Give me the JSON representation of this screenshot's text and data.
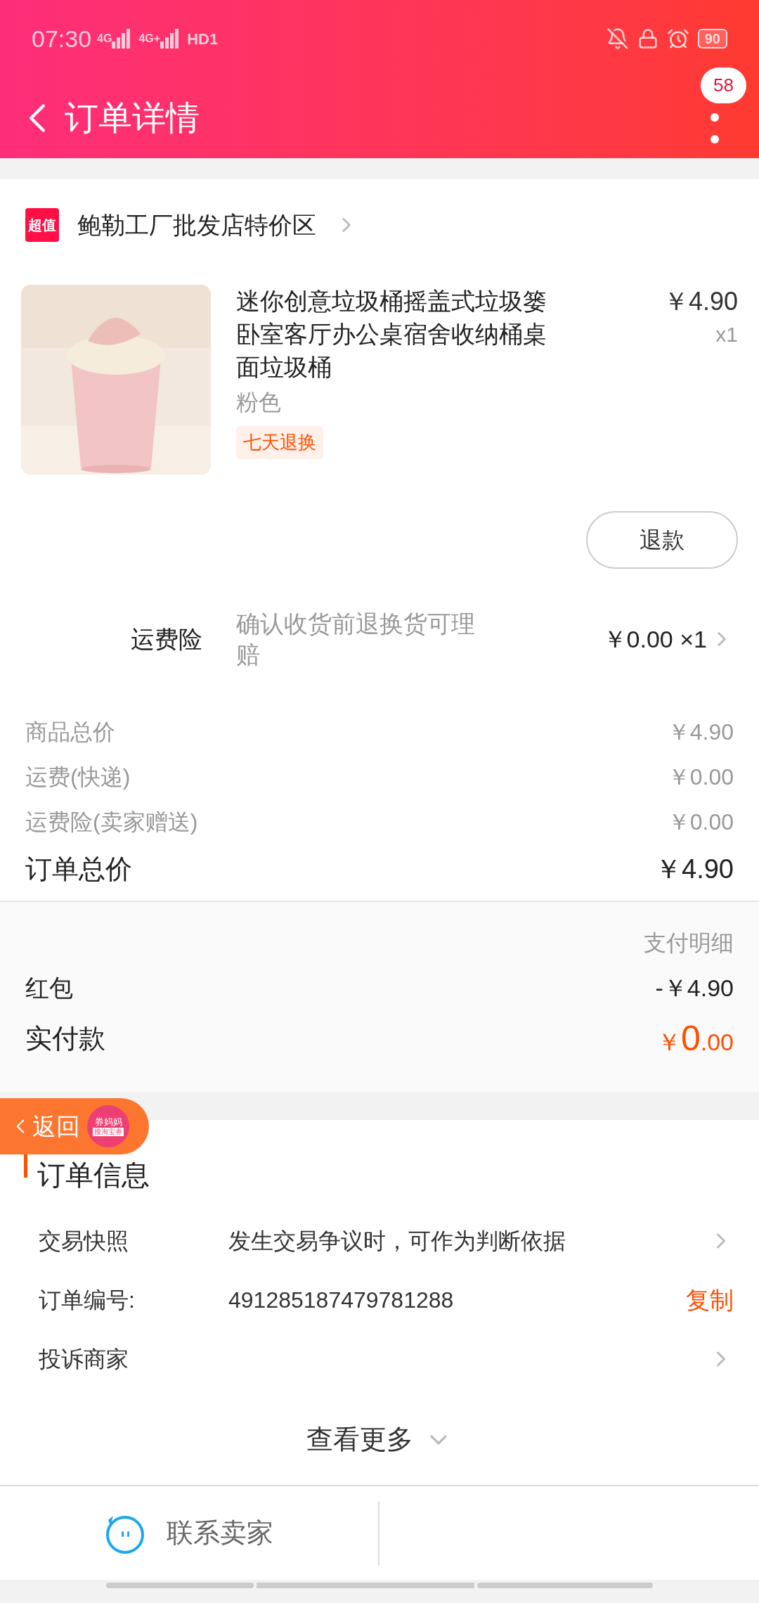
{
  "status_bar": {
    "time": "07:30",
    "network_1": "4G",
    "network_2": "4G+",
    "hd": "HD1",
    "battery": "90"
  },
  "header": {
    "title": "订单详情",
    "badge": "58"
  },
  "shop": {
    "logo": "超值",
    "name": "鲍勒工厂批发店特价区"
  },
  "product": {
    "title": "迷你创意垃圾桶摇盖式垃圾篓卧室客厅办公桌宿舍收纳桶桌面垃圾桶",
    "price": "￥4.90",
    "quantity": "x1",
    "variant": "粉色",
    "tag": "七天退换",
    "refund_button": "退款"
  },
  "insurance": {
    "label": "运费险",
    "description": "确认收货前退换货可理赔",
    "price": "￥0.00 ×1"
  },
  "summary": [
    {
      "label": "商品总价",
      "value": "￥4.90"
    },
    {
      "label": "运费(快递)",
      "value": "￥0.00"
    },
    {
      "label": "运费险(卖家赠送)",
      "value": "￥0.00"
    }
  ],
  "total": {
    "label": "订单总价",
    "value": "￥4.90"
  },
  "payment": {
    "detail_link": "支付明细",
    "discount_label": "红包",
    "discount_value": "-￥4.90",
    "paid_label": "实付款",
    "paid_currency": "￥",
    "paid_integer": "0",
    "paid_decimal": ".00"
  },
  "floating_back": {
    "label": "返回",
    "logo_top": "券妈妈",
    "logo_bottom": "搜淘宝券"
  },
  "order_info": {
    "title": "订单信息",
    "rows": [
      {
        "label": "交易快照",
        "value": "发生交易争议时，可作为判断依据",
        "action": "",
        "kind": "link"
      },
      {
        "label": "订单编号:",
        "value": "491285187479781288",
        "action": "复制",
        "kind": "copy"
      },
      {
        "label": "投诉商家",
        "value": "",
        "action": "",
        "kind": "link"
      }
    ],
    "more": "查看更多"
  },
  "bottom_bar": {
    "contact": "联系卖家"
  }
}
